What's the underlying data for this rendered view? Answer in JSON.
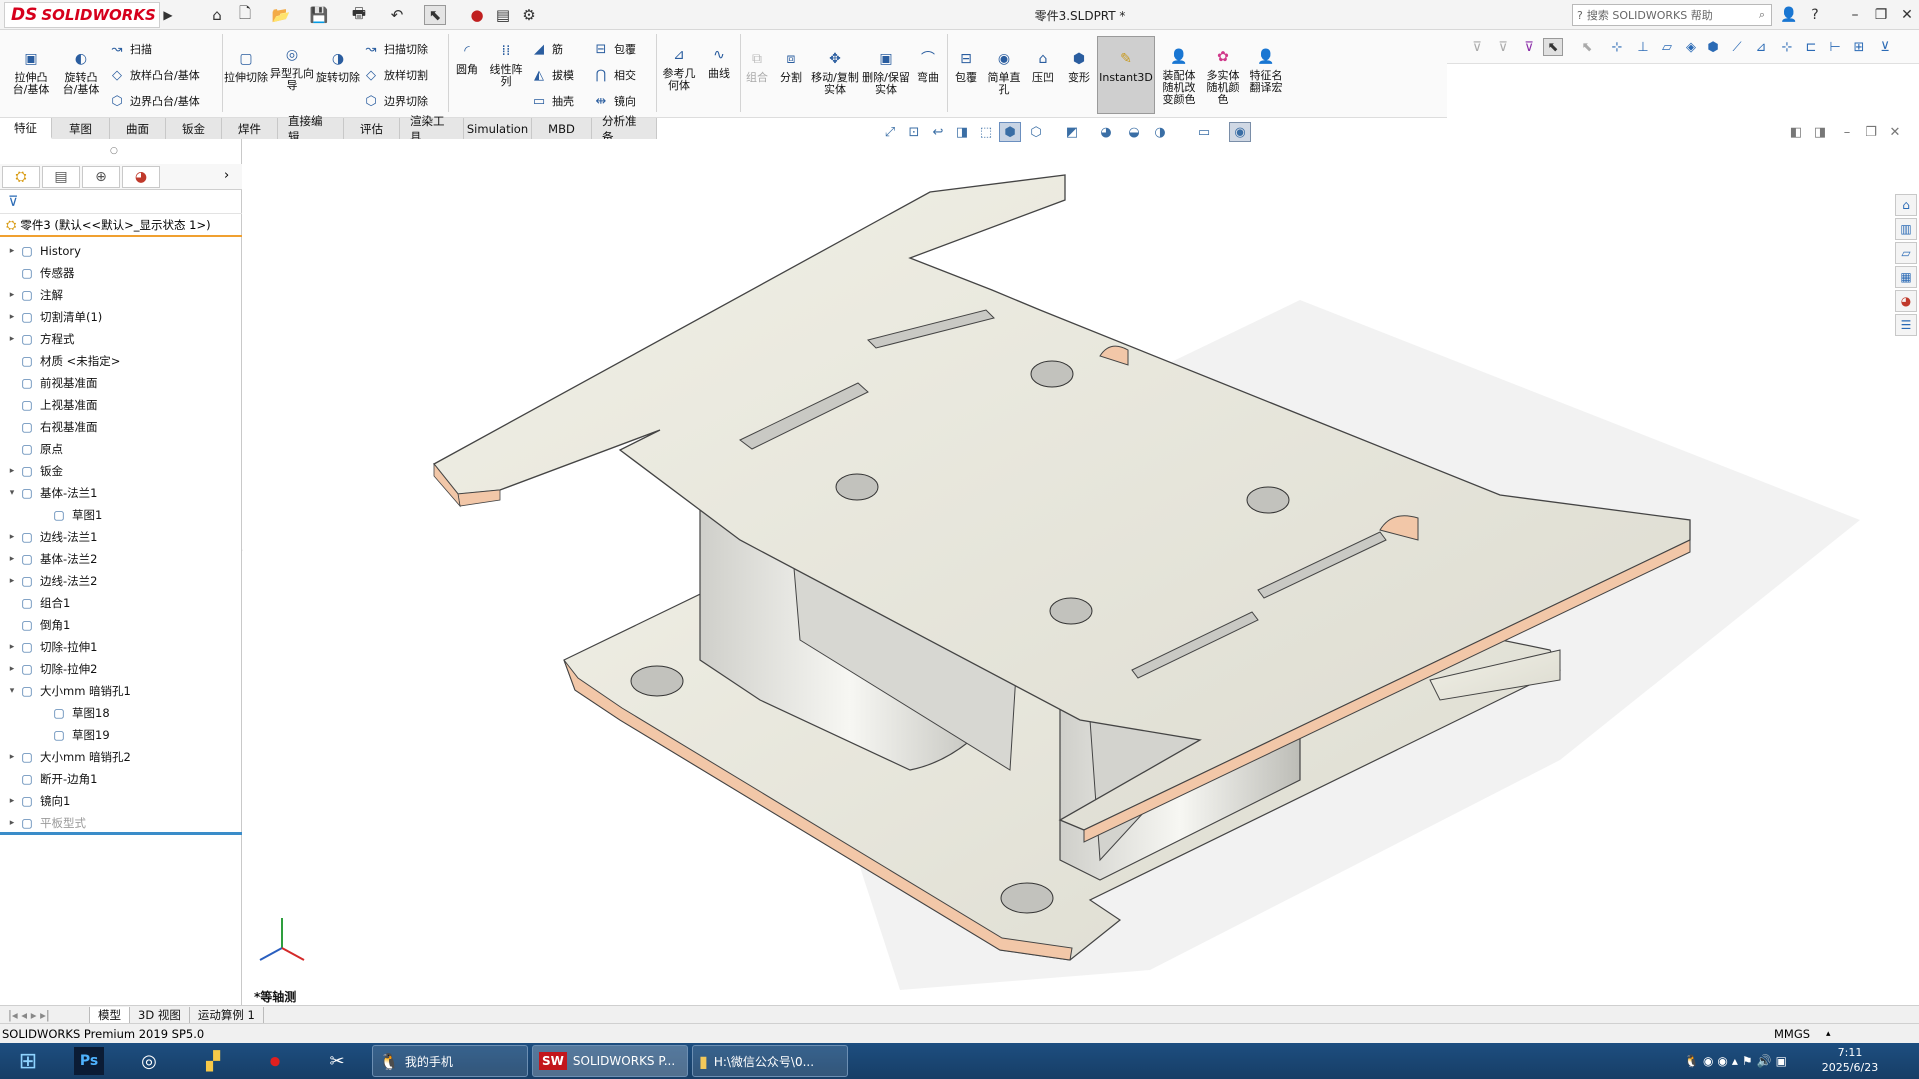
{
  "title_bar": {
    "logo_ds": "DS",
    "logo_text": "SOLIDWORKS",
    "document_title": "零件3.SLDPRT *",
    "search_placeholder": "搜索 SOLIDWORKS 帮助"
  },
  "command_manager": {
    "features": [
      {
        "label": "拉伸凸台/基体",
        "icon": "extrude-boss-icon"
      },
      {
        "label": "旋转凸台/基体",
        "icon": "revolve-boss-icon"
      },
      {
        "label": "扫描",
        "icon": "sweep-icon"
      },
      {
        "label": "放样凸台/基体",
        "icon": "loft-icon"
      },
      {
        "label": "边界凸台/基体",
        "icon": "boundary-boss-icon"
      },
      {
        "label": "拉伸切除",
        "icon": "extrude-cut-icon"
      },
      {
        "label": "异型孔向导",
        "icon": "hole-wizard-icon"
      },
      {
        "label": "旋转切除",
        "icon": "revolve-cut-icon"
      },
      {
        "label": "扫描切除",
        "icon": "swept-cut-icon"
      },
      {
        "label": "放样切割",
        "icon": "lofted-cut-icon"
      },
      {
        "label": "边界切除",
        "icon": "boundary-cut-icon"
      },
      {
        "label": "圆角",
        "icon": "fillet-icon"
      },
      {
        "label": "线性阵列",
        "icon": "linear-pattern-icon"
      },
      {
        "label": "筋",
        "icon": "rib-icon"
      },
      {
        "label": "拔模",
        "icon": "draft-icon"
      },
      {
        "label": "抽壳",
        "icon": "shell-icon"
      },
      {
        "label": "包覆",
        "icon": "wrap-icon"
      },
      {
        "label": "相交",
        "icon": "intersect-icon"
      },
      {
        "label": "镜向",
        "icon": "mirror-icon"
      },
      {
        "label": "参考几何体",
        "icon": "reference-geometry-icon"
      },
      {
        "label": "曲线",
        "icon": "curves-icon"
      },
      {
        "label": "组合",
        "icon": "combine-icon"
      },
      {
        "label": "分割",
        "icon": "split-icon"
      },
      {
        "label": "移动/复制实体",
        "icon": "move-copy-icon"
      },
      {
        "label": "删除/保留实体",
        "icon": "delete-keep-icon"
      },
      {
        "label": "弯曲",
        "icon": "flex-icon"
      },
      {
        "label": "包覆",
        "icon": "wrap-icon"
      },
      {
        "label": "简单直孔",
        "icon": "simple-hole-icon"
      },
      {
        "label": "压凹",
        "icon": "indent-icon"
      },
      {
        "label": "变形",
        "icon": "deform-icon"
      },
      {
        "label": "Instant3D",
        "icon": "instant3d-icon"
      },
      {
        "label": "装配体随机改变颜色",
        "icon": "assembly-color-icon"
      },
      {
        "label": "多实体随机颜色",
        "icon": "multibody-color-icon"
      },
      {
        "label": "特征名翻译宏",
        "icon": "translate-macro-icon"
      }
    ],
    "tabs": [
      "特征",
      "草图",
      "曲面",
      "钣金",
      "焊件",
      "直接编辑",
      "评估",
      "渲染工具",
      "Simulation",
      "MBD",
      "分析准备"
    ]
  },
  "feature_tree": {
    "root": "零件3 (默认<<默认>_显示状态 1>)",
    "items": [
      {
        "label": "History",
        "expand": "▸",
        "icon": "history-icon"
      },
      {
        "label": "传感器",
        "expand": "",
        "icon": "sensor-icon"
      },
      {
        "label": "注解",
        "expand": "▸",
        "icon": "annotation-icon"
      },
      {
        "label": "切割清单(1)",
        "expand": "▸",
        "icon": "cut-list-icon"
      },
      {
        "label": "方程式",
        "expand": "▸",
        "icon": "equation-icon"
      },
      {
        "label": "材质 <未指定>",
        "expand": "",
        "icon": "material-icon"
      },
      {
        "label": "前视基准面",
        "expand": "",
        "icon": "plane-icon"
      },
      {
        "label": "上视基准面",
        "expand": "",
        "icon": "plane-icon"
      },
      {
        "label": "右视基准面",
        "expand": "",
        "icon": "plane-icon"
      },
      {
        "label": "原点",
        "expand": "",
        "icon": "origin-icon"
      },
      {
        "label": "钣金",
        "expand": "▸",
        "icon": "sheet-metal-icon"
      },
      {
        "label": "基体-法兰1",
        "expand": "▾",
        "icon": "base-flange-icon"
      },
      {
        "label": "草图1",
        "expand": "",
        "icon": "sketch-icon",
        "indent": true
      },
      {
        "label": "边线-法兰1",
        "expand": "▸",
        "icon": "edge-flange-icon"
      },
      {
        "label": "基体-法兰2",
        "expand": "▸",
        "icon": "base-flange-icon"
      },
      {
        "label": "边线-法兰2",
        "expand": "▸",
        "icon": "edge-flange-icon"
      },
      {
        "label": "组合1",
        "expand": "",
        "icon": "combine-icon"
      },
      {
        "label": "倒角1",
        "expand": "",
        "icon": "chamfer-icon"
      },
      {
        "label": "切除-拉伸1",
        "expand": "▸",
        "icon": "cut-extrude-icon"
      },
      {
        "label": "切除-拉伸2",
        "expand": "▸",
        "icon": "cut-extrude-icon"
      },
      {
        "label": "大小mm 暗销孔1",
        "expand": "▾",
        "icon": "dowel-hole-icon"
      },
      {
        "label": "草图18",
        "expand": "",
        "icon": "sketch-icon",
        "indent": true
      },
      {
        "label": "草图19",
        "expand": "",
        "icon": "sketch-icon",
        "indent": true
      },
      {
        "label": "大小mm 暗销孔2",
        "expand": "▸",
        "icon": "dowel-hole-icon"
      },
      {
        "label": "断开-边角1",
        "expand": "",
        "icon": "break-corner-icon"
      },
      {
        "label": "镜向1",
        "expand": "▸",
        "icon": "mirror-icon"
      },
      {
        "label": "平板型式",
        "expand": "▸",
        "icon": "flat-pattern-icon",
        "dim": true
      }
    ]
  },
  "viewport": {
    "view_label": "*等轴测",
    "part_color": "#e9e8dc",
    "edge_color": "#f0c4a8"
  },
  "bottom_tabs": [
    "模型",
    "3D 视图",
    "运动算例 1"
  ],
  "status_bar": {
    "product": "SOLIDWORKS Premium 2019 SP5.0",
    "units": "MMGS"
  },
  "taskbar": {
    "tasks": [
      "我的手机",
      "SOLIDWORKS P...",
      "H:\\微信公众号\\0..."
    ],
    "time": "7:11",
    "date": "2025/6/23"
  }
}
